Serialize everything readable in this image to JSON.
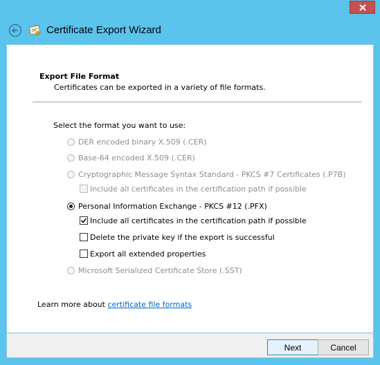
{
  "window": {
    "title": "Certificate Export Wizard"
  },
  "page": {
    "heading": "Export File Format",
    "description": "Certificates can be exported in a variety of file formats.",
    "prompt": "Select the format you want to use:"
  },
  "options": {
    "der": {
      "label": "DER encoded binary X.509 (.CER)",
      "enabled": false,
      "selected": false
    },
    "base64": {
      "label": "Base-64 encoded X.509 (.CER)",
      "enabled": false,
      "selected": false
    },
    "pkcs7": {
      "label": "Cryptographic Message Syntax Standard - PKCS #7 Certificates (.P7B)",
      "enabled": false,
      "selected": false
    },
    "pkcs7_include": {
      "label": "Include all certificates in the certification path if possible",
      "enabled": false,
      "checked": false
    },
    "pfx": {
      "label": "Personal Information Exchange - PKCS #12 (.PFX)",
      "enabled": true,
      "selected": true
    },
    "pfx_include": {
      "label": "Include all certificates in the certification path if possible",
      "enabled": true,
      "checked": true
    },
    "pfx_delete_key": {
      "label": "Delete the private key if the export is successful",
      "enabled": true,
      "checked": false
    },
    "pfx_export_ext": {
      "label": "Export all extended properties",
      "enabled": true,
      "checked": false
    },
    "sst": {
      "label": "Microsoft Serialized Certificate Store (.SST)",
      "enabled": false,
      "selected": false
    }
  },
  "learn_more": {
    "prefix": "Learn more about ",
    "link": "certificate file formats"
  },
  "buttons": {
    "next": "Next",
    "cancel": "Cancel"
  },
  "icons": {
    "close": "close-icon",
    "back": "back-arrow-icon",
    "certificate": "certificate-icon"
  }
}
